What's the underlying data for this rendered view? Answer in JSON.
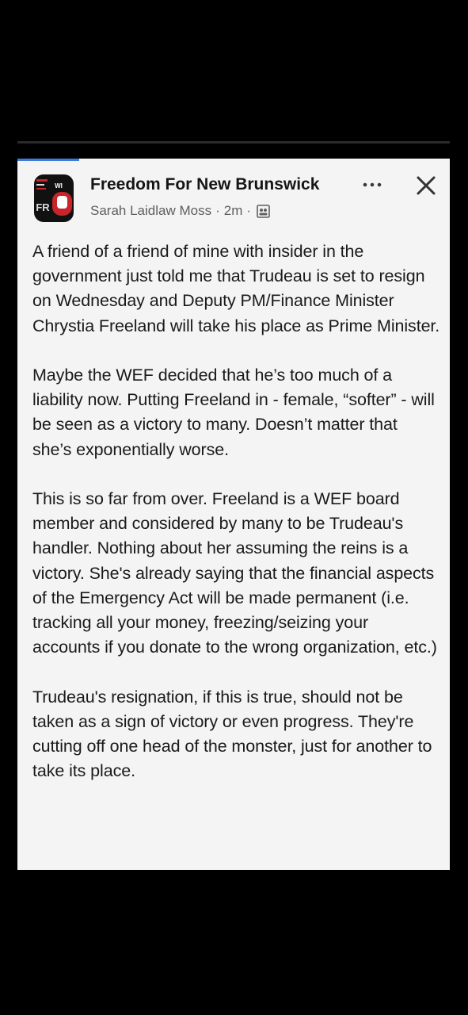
{
  "post": {
    "group_name": "Freedom For New Brunswick",
    "author": "Sarah Laidlaw Moss",
    "time": "2m",
    "separator": "·",
    "avatar_badge": "WI",
    "avatar_text": "FR",
    "paragraphs": [
      "A friend of a friend of mine with insider in the government just told me that Trudeau is set to resign on Wednesday and Deputy PM/Finance Minister Chrystia Freeland will take his place as Prime Minister.",
      "Maybe the WEF decided that he’s too much of a liability now. Putting Freeland in - female, “softer” - will be seen as a victory to many. Doesn’t matter that she’s exponentially worse.",
      "This is so far from over.  Freeland is a WEF board member and considered by many to be Trudeau's handler.  Nothing about her assuming the reins is a victory.  She's already saying that the financial aspects of the Emergency Act will be made permanent (i.e. tracking all your money, freezing/seizing your accounts if you donate to the wrong organization, etc.)",
      "Trudeau's resignation, if this is true, should not be taken as a sign of victory or even progress. They're cutting off one head of the monster, just for another to take its place."
    ]
  },
  "icons": {
    "more": "more-horizontal-icon",
    "close": "close-icon",
    "privacy": "group-privacy-icon"
  },
  "colors": {
    "card_background": "#f4f4f4",
    "text": "#1a1a1a",
    "meta_text": "#5f5f5f",
    "accent": "#3b7ddd",
    "avatar_red": "#c8242b"
  }
}
